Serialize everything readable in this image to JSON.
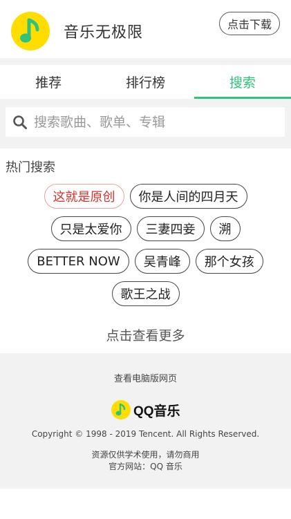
{
  "header": {
    "app_name": "音乐无极限",
    "download_label": "点击下载"
  },
  "tabs": [
    {
      "label": "推荐",
      "active": false
    },
    {
      "label": "排行榜",
      "active": false
    },
    {
      "label": "搜索",
      "active": true
    }
  ],
  "search": {
    "placeholder": "搜索歌曲、歌单、专辑",
    "value": ""
  },
  "hot_search": {
    "title": "热门搜索",
    "rows": [
      [
        "这就是原创",
        "你是人间的四月天"
      ],
      [
        "只是太爱你",
        "三妻四妾",
        "溯"
      ],
      [
        "BETTER NOW",
        "吴青峰",
        "那个女孩"
      ],
      [
        "歌王之战"
      ]
    ],
    "highlighted": "这就是原创",
    "more_label": "点击查看更多"
  },
  "footer": {
    "pc_link": "查看电脑版网页",
    "brand": "QQ音乐",
    "copyright": "Copyright © 1998 - 2019 Tencent. All Rights Reserved.",
    "disclaimer": "资源仅供学术使用，请勿商用",
    "official_site": "官方网站：QQ 音乐"
  },
  "colors": {
    "accent": "#31c27c",
    "logo_yellow": "#ffdd00",
    "logo_green": "#31c27c",
    "hot_tag": "#d4322e"
  }
}
